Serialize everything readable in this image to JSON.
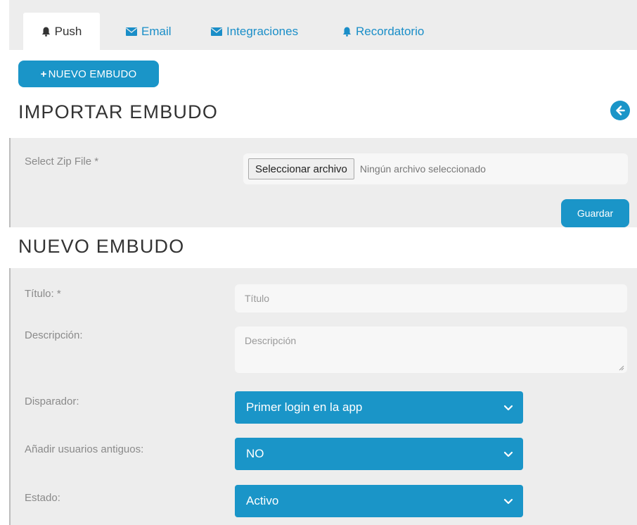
{
  "tabs": [
    {
      "label": "Push",
      "icon": "bell-icon",
      "active": true
    },
    {
      "label": "Email",
      "icon": "envelope-icon",
      "active": false
    },
    {
      "label": "Integraciones",
      "icon": "envelope-icon",
      "active": false
    },
    {
      "label": "Recordatorio",
      "icon": "bell-icon",
      "active": false
    }
  ],
  "new_button": {
    "label": "NUEVO EMBUDO",
    "icon": "plus-icon"
  },
  "import_section": {
    "title": "IMPORTAR EMBUDO",
    "back_icon": "arrow-left-circle-icon",
    "zip_label": "Select Zip File *",
    "file_button": "Seleccionar archivo",
    "file_status": "Ningún archivo seleccionado",
    "save_label": "Guardar"
  },
  "new_section": {
    "title": "NUEVO EMBUDO",
    "title_field": {
      "label": "Título: *",
      "placeholder": "Título"
    },
    "description_field": {
      "label": "Descripción:",
      "placeholder": "Descripción"
    },
    "trigger": {
      "label": "Disparador:",
      "value": "Primer login en la app"
    },
    "add_old_users": {
      "label": "Añadir usuarios antiguos:",
      "value": "NO"
    },
    "status": {
      "label": "Estado:",
      "value": "Activo"
    }
  },
  "colors": {
    "accent": "#1a95c8",
    "panel": "#ededed",
    "field": "#f7f7f7"
  }
}
